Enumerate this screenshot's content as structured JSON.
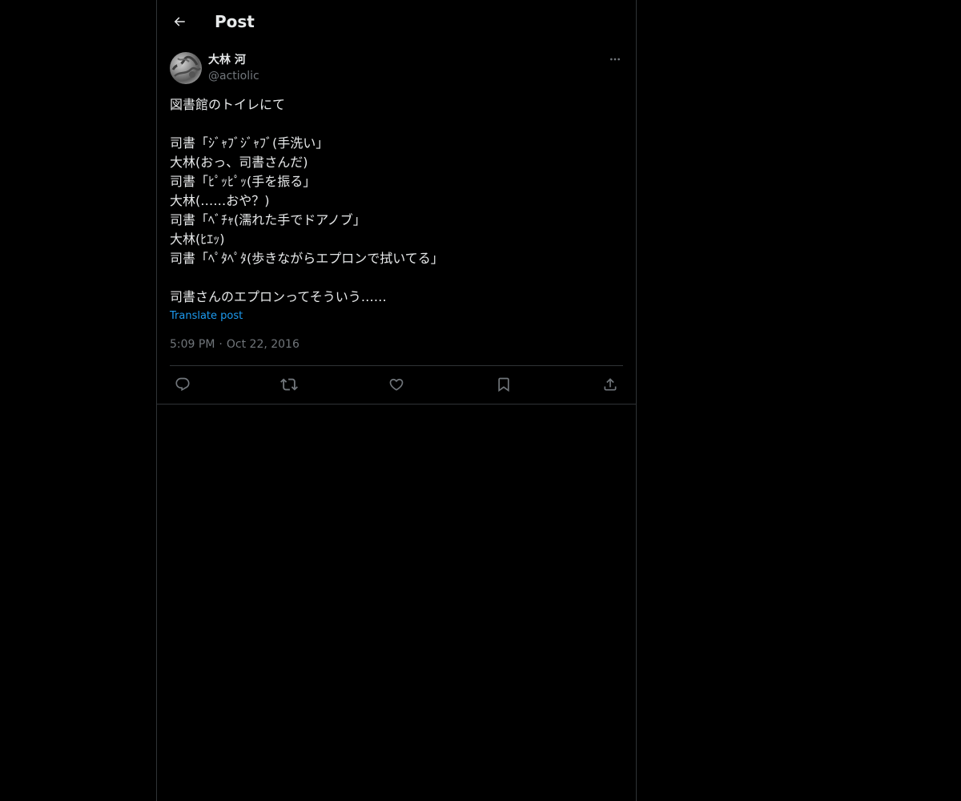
{
  "header": {
    "title": "Post",
    "back_icon": "arrow-left-icon"
  },
  "post": {
    "author": {
      "display_name": "大林 河",
      "handle": "@actiolic",
      "avatar_icon": "avatar-image"
    },
    "more_icon": "more-horizontal-icon",
    "lines": [
      "図書館のトイレにて",
      "",
      "司書「ｼﾞｬﾌﾞｼﾞｬﾌﾞ(手洗い」",
      "大林(おっ、司書さんだ)",
      "司書「ﾋﾟｯﾋﾟｯ(手を振る」",
      "大林(……おや？)",
      "司書「ﾍﾞﾁｬ(濡れた手でドアノブ」",
      "大林(ﾋｴｯ)",
      "司書「ﾍﾟﾀﾍﾟﾀ(歩きながらエプロンで拭いてる」",
      "",
      "司書さんのエプロンってそういう……"
    ],
    "translate_label": "Translate post",
    "time": "5:09 PM",
    "separator": "·",
    "date": "Oct 22, 2016"
  },
  "actions": [
    {
      "name": "reply",
      "icon": "reply-icon"
    },
    {
      "name": "repost",
      "icon": "repost-icon"
    },
    {
      "name": "like",
      "icon": "heart-icon"
    },
    {
      "name": "bookmark",
      "icon": "bookmark-icon"
    },
    {
      "name": "share",
      "icon": "share-icon"
    }
  ],
  "colors": {
    "background": "#000000",
    "text": "#e7e9ea",
    "secondary_text": "#71767b",
    "link": "#1d9bf0",
    "border": "#2f3336"
  }
}
